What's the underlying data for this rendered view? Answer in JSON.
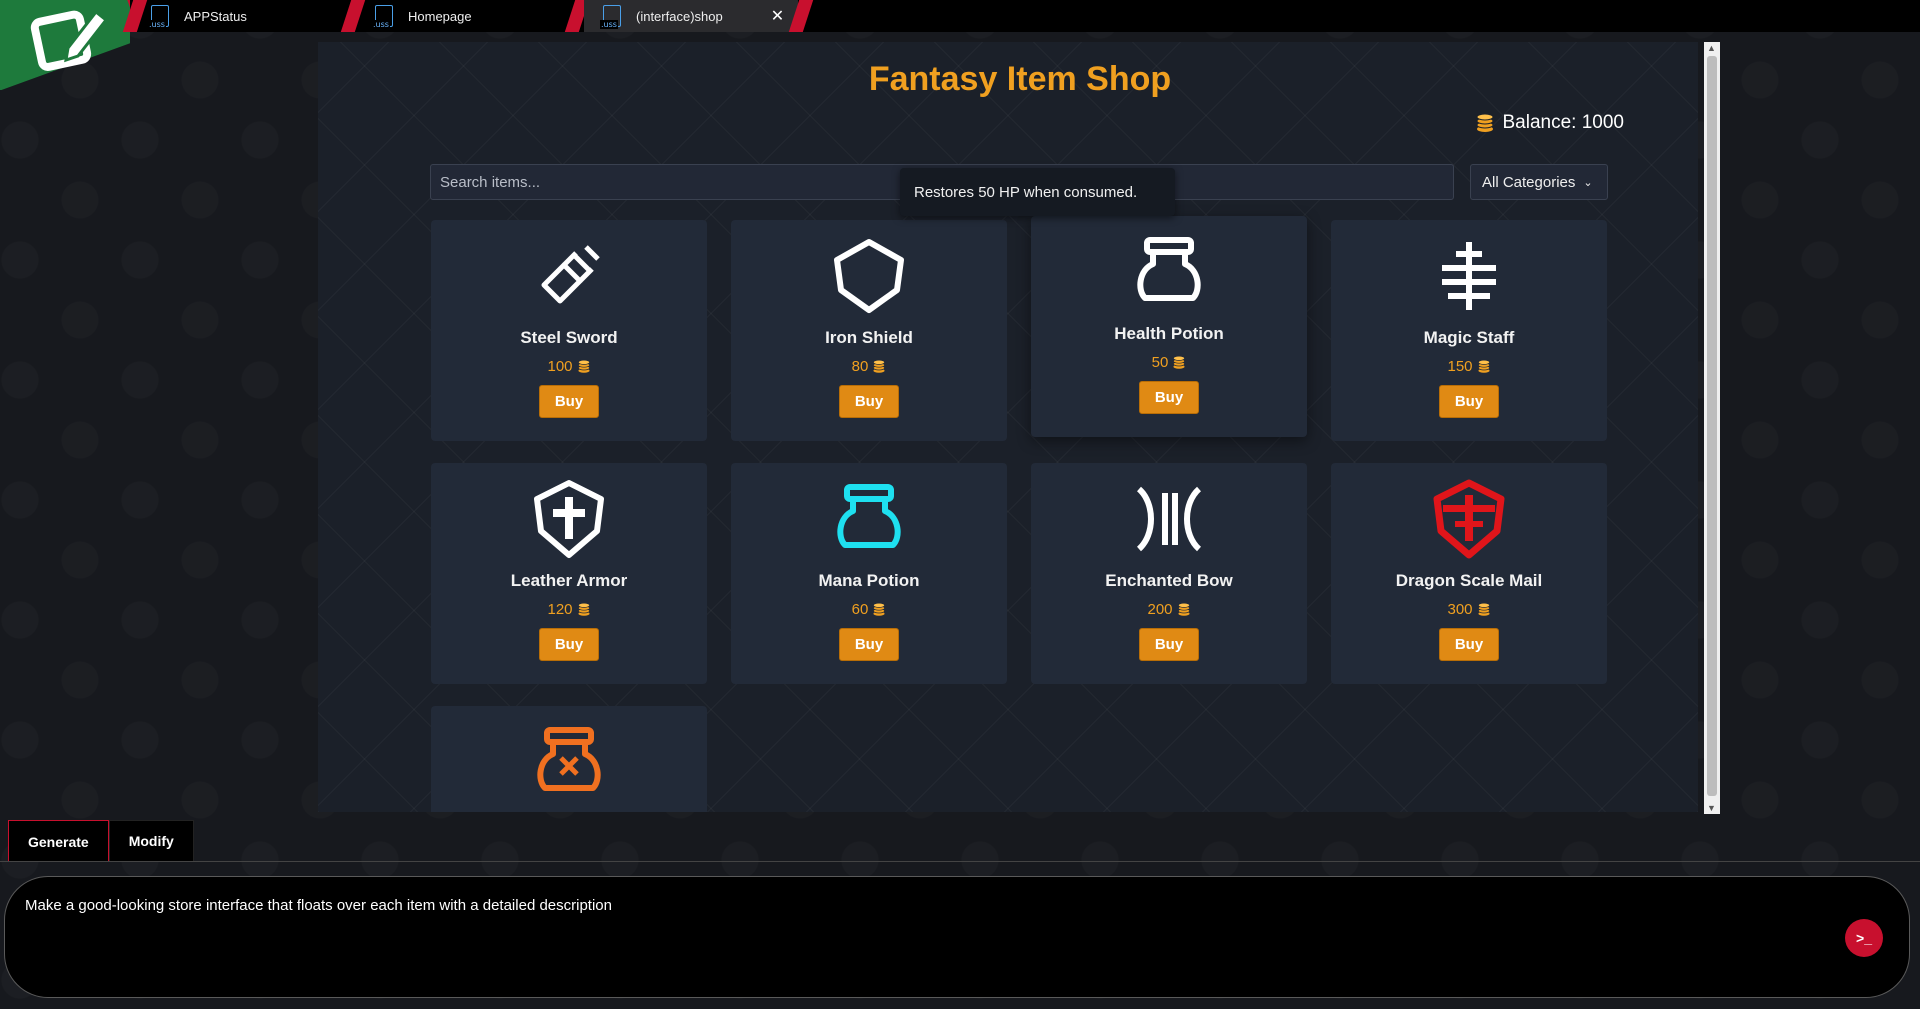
{
  "tabs": [
    {
      "label": "APPStatus",
      "ext": ".uss"
    },
    {
      "label": "Homepage",
      "ext": ".uss"
    },
    {
      "label": "(interface)shop",
      "ext": ".uss",
      "close": "✕"
    }
  ],
  "shop": {
    "title": "Fantasy Item Shop",
    "balance": "Balance: 1000",
    "search_placeholder": "Search items...",
    "category": "All Categories",
    "tooltip": "Restores 50 HP when consumed.",
    "buy_label": "Buy",
    "items": [
      {
        "name": "Steel Sword",
        "price": "100",
        "icon": "sword-icon",
        "color": "#ffffff"
      },
      {
        "name": "Iron Shield",
        "price": "80",
        "icon": "shield-icon",
        "color": "#ffffff"
      },
      {
        "name": "Health Potion",
        "price": "50",
        "icon": "potion-icon",
        "color": "#ffffff"
      },
      {
        "name": "Magic Staff",
        "price": "150",
        "icon": "staff-icon",
        "color": "#ffffff"
      },
      {
        "name": "Leather Armor",
        "price": "120",
        "icon": "armor-icon",
        "color": "#ffffff"
      },
      {
        "name": "Mana Potion",
        "price": "60",
        "icon": "potion-icon",
        "color": "#1ee0f0"
      },
      {
        "name": "Enchanted Bow",
        "price": "200",
        "icon": "bow-icon",
        "color": "#ffffff"
      },
      {
        "name": "Dragon Scale Mail",
        "price": "300",
        "icon": "armor-icon",
        "color": "#e0151a"
      },
      {
        "name": "",
        "price": "",
        "icon": "poison-potion-icon",
        "color": "#f07020"
      }
    ]
  },
  "bottom": {
    "tabs": [
      "Generate",
      "Modify"
    ],
    "prompt": "Make a good-looking store interface that floats over each item with a detailed description"
  },
  "colors": {
    "accent": "#f0a020",
    "brand_red": "#c8102e",
    "brand_green": "#1e7a3c"
  }
}
